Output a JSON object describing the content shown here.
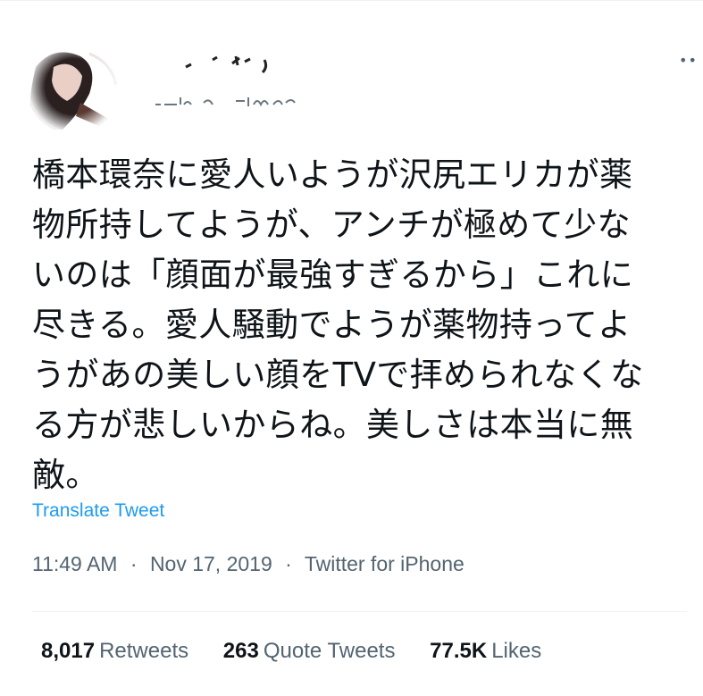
{
  "tweet": {
    "more_icon": "more-horizontal-icon",
    "text_lines": [
      "橋本環奈に愛人いようが沢尻エリカが薬",
      "物所持してようが、アンチが極めて少な",
      "いのは「顔面が最強すぎるから」これに",
      "尽きる。愛人騒動でようが薬物持ってよ",
      "うがあの美しい顔をTVで拝められなくな",
      "る方が悲しいからね。美しさは本当に無",
      "敵。"
    ],
    "translate_label": "Translate Tweet",
    "time": "11:49 AM",
    "separator": "·",
    "date": "Nov 17, 2019",
    "source": "Twitter for iPhone"
  },
  "stats": {
    "retweets_count": "8,017",
    "retweets_label": "Retweets",
    "quotes_count": "263",
    "quotes_label": "Quote Tweets",
    "likes_count": "77.5K",
    "likes_label": "Likes"
  },
  "colors": {
    "link": "#1d9bf0",
    "secondary_text": "#536471",
    "primary_text": "#0f1419"
  }
}
